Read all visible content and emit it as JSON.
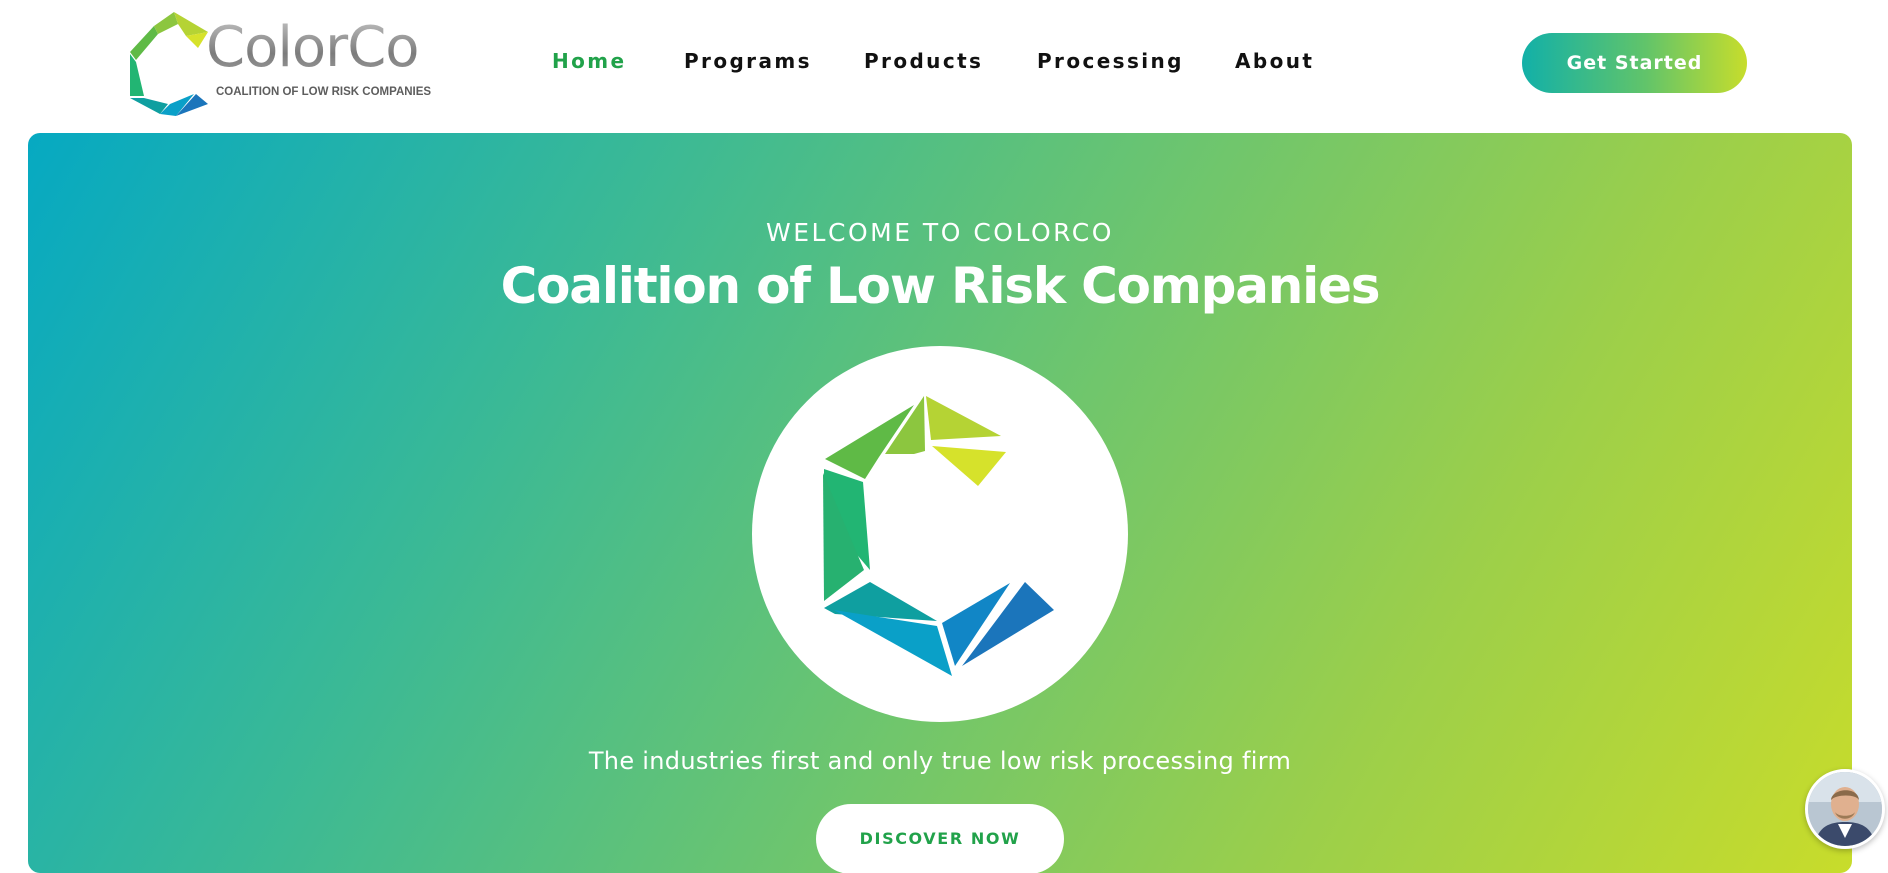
{
  "brand": {
    "name": "ColorCo",
    "tagline": "COALITION OF LOW RISK COMPANIES"
  },
  "nav": {
    "items": [
      {
        "label": "Home",
        "active": true
      },
      {
        "label": "Programs",
        "active": false
      },
      {
        "label": "Products",
        "active": false
      },
      {
        "label": "Processing",
        "active": false
      },
      {
        "label": "About",
        "active": false
      }
    ],
    "cta_label": "Get Started"
  },
  "hero": {
    "eyebrow": "WELCOME TO COLORCO",
    "title": "Coalition of Low Risk Companies",
    "tagline": "The industries first and only true low risk processing firm",
    "button_label": "DISCOVER NOW"
  },
  "icons": {
    "logo": "colorco-c-mark-icon",
    "emblem": "colorco-c-mark-icon",
    "chat": "chat-agent-avatar"
  },
  "colors": {
    "nav_active": "#21a24a",
    "nav_default": "#111111",
    "gradient_start": "#06a9c2",
    "gradient_end": "#c8dc2b",
    "button_text": "#21a24a"
  }
}
